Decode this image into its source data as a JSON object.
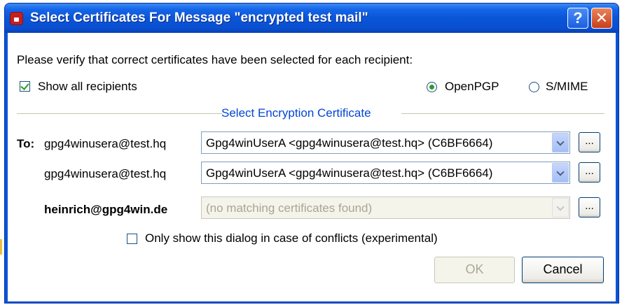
{
  "window": {
    "title": "Select Certificates For Message \"encrypted test mail\"",
    "help_label": "?",
    "close_label": "✕"
  },
  "intro_text": "Please verify that correct certificates have been selected for each recipient:",
  "show_all": {
    "label": "Show all recipients",
    "checked": true
  },
  "protocol": {
    "options": [
      {
        "label": "OpenPGP",
        "selected": true
      },
      {
        "label": "S/MIME",
        "selected": false
      }
    ]
  },
  "section_title": "Select Encryption Certificate",
  "to_label": "To:",
  "recipients": [
    {
      "address": "gpg4winusera@test.hq",
      "bold": false,
      "certificate": "Gpg4winUserA <gpg4winusera@test.hq> (C6BF6664)",
      "enabled": true,
      "browse_label": "..."
    },
    {
      "address": "gpg4winusera@test.hq",
      "bold": false,
      "certificate": "Gpg4winUserA <gpg4winusera@test.hq> (C6BF6664)",
      "enabled": true,
      "browse_label": "..."
    },
    {
      "address": "heinrich@gpg4win.de",
      "bold": true,
      "certificate": "(no matching certificates found)",
      "enabled": false,
      "browse_label": "..."
    }
  ],
  "conflicts_option": {
    "label": "Only show this dialog in case of conflicts (experimental)",
    "checked": false
  },
  "buttons": {
    "ok_label": "OK",
    "cancel_label": "Cancel"
  },
  "colors": {
    "titlebar": "#0a55d8",
    "section_title": "#0046d5",
    "radio_dot": "#2f9a2f"
  }
}
